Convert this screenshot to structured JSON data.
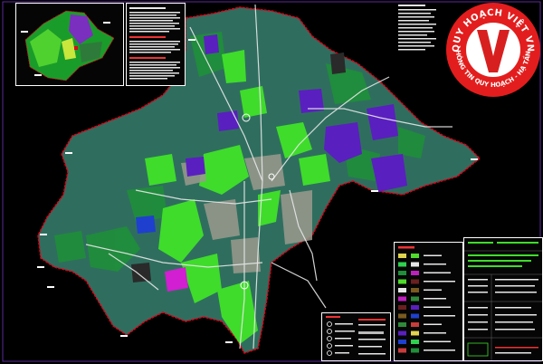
{
  "watermark": {
    "top_text": "QUY HOẠCH VIỆT VN",
    "bottom_text": "THÔNG TIN QUY HOẠCH - HẠ TẦNG",
    "letter": "V",
    "colors": {
      "ring": "#e31d1d",
      "inner": "#ffffff",
      "letter": "#d81f1f"
    }
  },
  "map_colors": {
    "background": "#000000",
    "boundary": "#e0001b",
    "base_land": "#2f6e5e",
    "green_space": "#3fdc2b",
    "forest": "#1f8f3a",
    "residential": "#9a9a8e",
    "industrial_purple": "#5a1fbf",
    "magenta_zone": "#d11fd1",
    "blue_zone": "#1f3fcf",
    "road": "#e8e8e8"
  },
  "inset_map": {
    "colors": [
      "#1a9c2a",
      "#4fd12f",
      "#7a2fbf",
      "#c8e63c",
      "#2e7a3a"
    ]
  },
  "legend": {
    "icon": "legend-swatches",
    "swatch_colors": [
      "#e0d44f",
      "#2fd14f",
      "#1f8f3a",
      "#4fdc2b",
      "#e6e6e6",
      "#bf1fbf",
      "#6b1f1f",
      "#7a5a1f",
      "#2e8a3a",
      "#5a1fbf",
      "#1f3fcf",
      "#c83c3c"
    ]
  },
  "symbols_panel": {
    "icon": "map-symbols"
  },
  "title_block": {
    "icon": "title-block-table"
  }
}
